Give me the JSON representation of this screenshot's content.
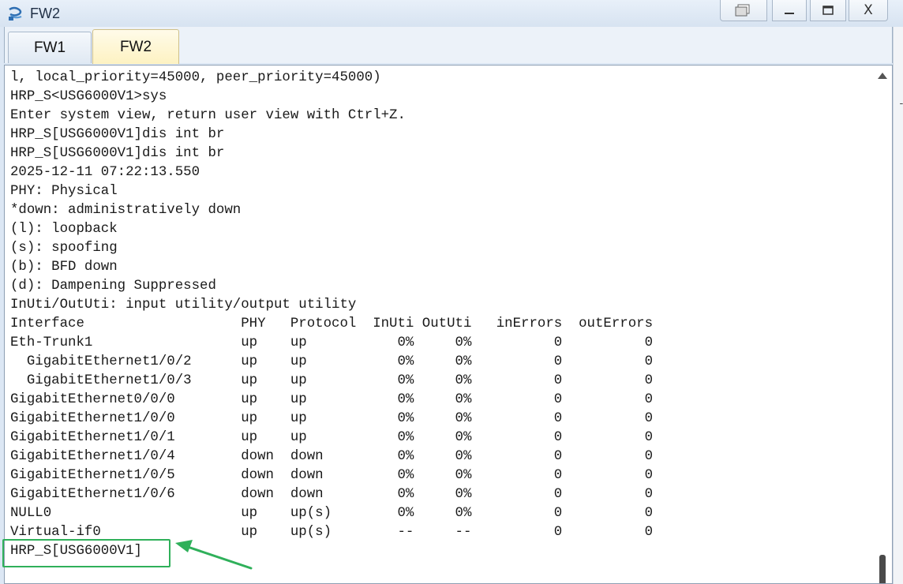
{
  "window": {
    "title": "FW2",
    "controls": {
      "restore": "",
      "minimize": "_",
      "maximize": "☐",
      "close": "X"
    }
  },
  "tabs": [
    {
      "label": "FW1",
      "active": false
    },
    {
      "label": "FW2",
      "active": true
    }
  ],
  "console": {
    "lines": [
      "l, local_priority=45000, peer_priority=45000)",
      "HRP_S<USG6000V1>sys",
      "Enter system view, return user view with Ctrl+Z.",
      "HRP_S[USG6000V1]dis int br",
      "HRP_S[USG6000V1]dis int br",
      "2025-12-11 07:22:13.550",
      "PHY: Physical",
      "*down: administratively down",
      "(l): loopback",
      "(s): spoofing",
      "(b): BFD down",
      "(d): Dampening Suppressed",
      "InUti/OutUti: input utility/output utility",
      "Interface                   PHY   Protocol  InUti OutUti   inErrors  outErrors",
      "Eth-Trunk1                  up    up           0%     0%          0          0",
      "  GigabitEthernet1/0/2      up    up           0%     0%          0          0",
      "  GigabitEthernet1/0/3      up    up           0%     0%          0          0",
      "GigabitEthernet0/0/0        up    up           0%     0%          0          0",
      "GigabitEthernet1/0/0        up    up           0%     0%          0          0",
      "GigabitEthernet1/0/1        up    up           0%     0%          0          0",
      "GigabitEthernet1/0/4        down  down         0%     0%          0          0",
      "GigabitEthernet1/0/5        down  down         0%     0%          0          0",
      "GigabitEthernet1/0/6        down  down         0%     0%          0          0",
      "NULL0                       up    up(s)        0%     0%          0          0",
      "Virtual-if0                 up    up(s)        --     --          0          0",
      "HRP_S[USG6000V1]"
    ]
  },
  "annotation": {
    "color": "#2fb05a"
  }
}
